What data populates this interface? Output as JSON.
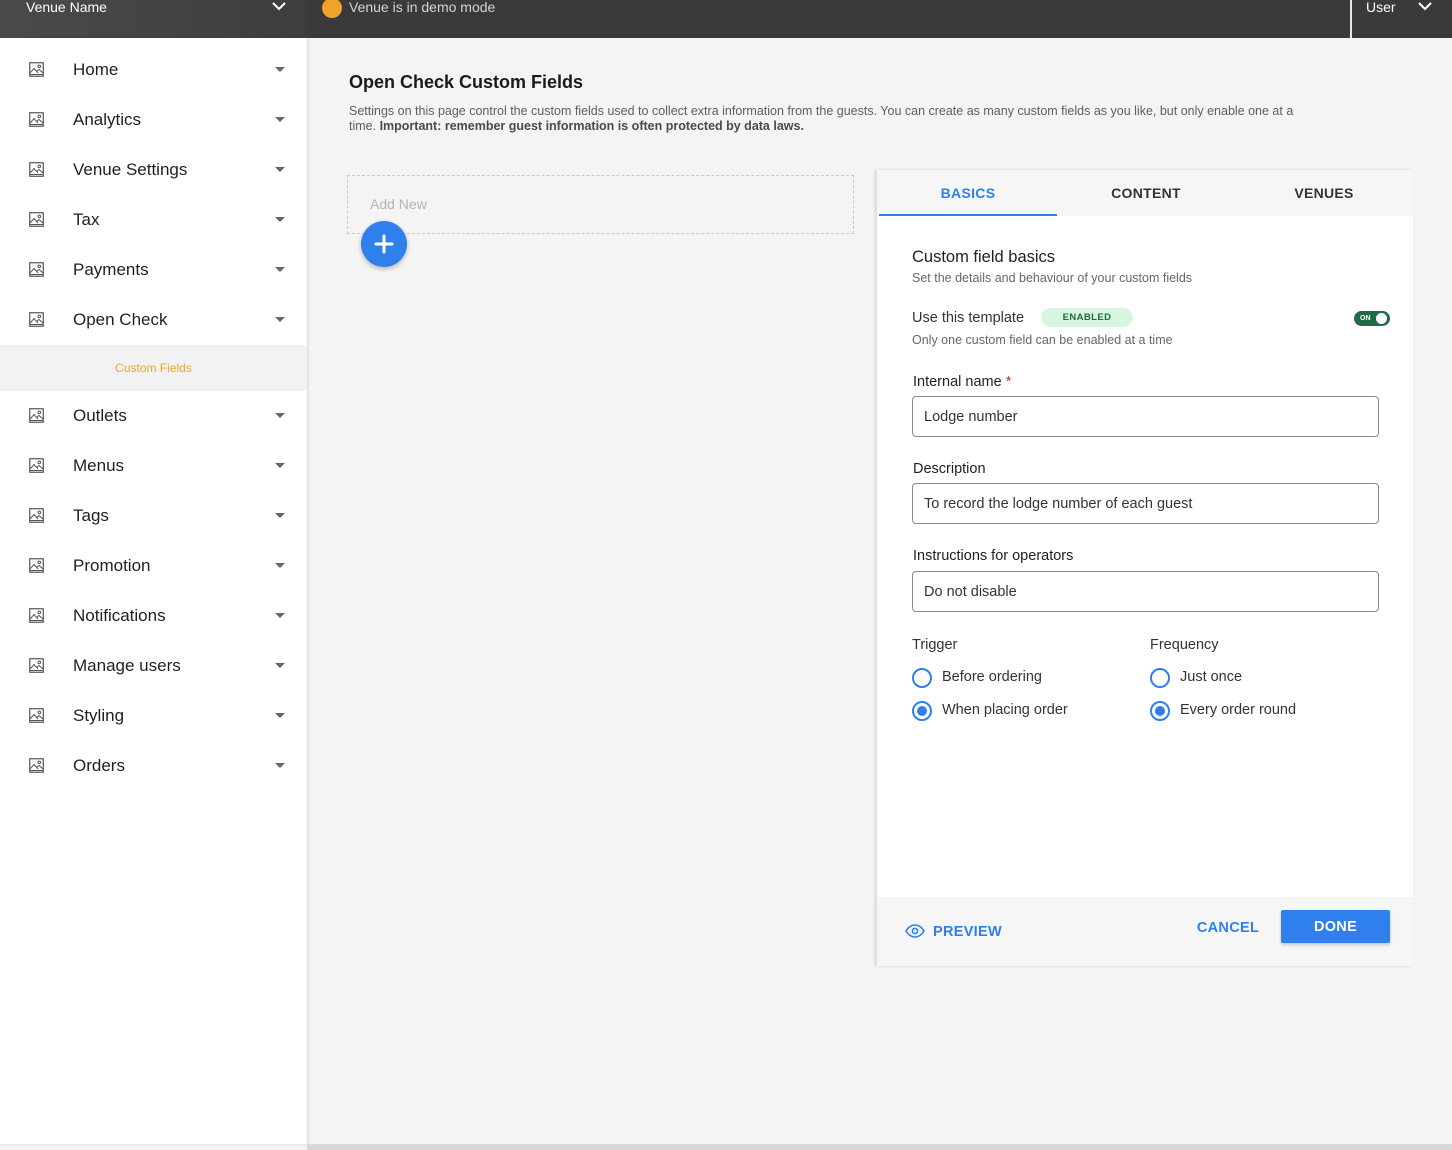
{
  "topbar": {
    "venue_name": "Venue Name",
    "demo_text": "Venue is in demo mode",
    "user_label": "User",
    "demo_color": "#f0a42c"
  },
  "sidebar": {
    "items": [
      {
        "label": "Home",
        "icon": "image-icon"
      },
      {
        "label": "Analytics",
        "icon": "image-icon"
      },
      {
        "label": "Venue Settings",
        "icon": "image-icon"
      },
      {
        "label": "Tax",
        "icon": "image-icon"
      },
      {
        "label": "Payments",
        "icon": "image-icon"
      },
      {
        "label": "Open Check",
        "icon": "image-icon"
      },
      {
        "label": "Outlets",
        "icon": "image-icon"
      },
      {
        "label": "Menus",
        "icon": "image-icon"
      },
      {
        "label": "Tags",
        "icon": "image-icon"
      },
      {
        "label": "Promotion",
        "icon": "image-icon"
      },
      {
        "label": "Notifications",
        "icon": "image-icon"
      },
      {
        "label": "Manage users",
        "icon": "image-icon"
      },
      {
        "label": "Styling",
        "icon": "image-icon"
      },
      {
        "label": "Orders",
        "icon": "image-icon"
      }
    ],
    "sub_item": "Custom Fields",
    "active_color": "#f0a42c"
  },
  "main": {
    "title": "Open Check Custom Fields",
    "description": "Settings on this page control the custom fields used to collect extra information from the guests. You can create as many custom fields as you like, but only enable one at a time. ",
    "description_strong": "Important: remember guest information is often protected by data laws.",
    "add_new": "Add New"
  },
  "panel": {
    "tabs": [
      {
        "label": "BASICS",
        "active": true
      },
      {
        "label": "CONTENT",
        "active": false
      },
      {
        "label": "VENUES",
        "active": false
      }
    ],
    "section_title": "Custom field basics",
    "section_subtitle": "Set the details and behaviour of your custom fields",
    "use_template_label": "Use this template",
    "enabled_badge": "ENABLED",
    "toggle_label": "ON",
    "only_one_note": "Only one custom field can be enabled at a time",
    "internal_name_label": "Internal name",
    "required_marker": "*",
    "internal_name_value": "Lodge number",
    "description_label": "Description",
    "description_value": "To record the lodge number of each guest",
    "instructions_label": "Instructions for operators",
    "instructions_value": "Do not disable",
    "trigger_label": "Trigger",
    "trigger_options": [
      {
        "label": "Before ordering",
        "selected": false
      },
      {
        "label": "When placing order",
        "selected": true
      }
    ],
    "frequency_label": "Frequency",
    "frequency_options": [
      {
        "label": "Just once",
        "selected": false
      },
      {
        "label": "Every order round",
        "selected": true
      }
    ],
    "preview_label": "PREVIEW",
    "cancel_label": "CANCEL",
    "done_label": "DONE",
    "accent_color": "#2f80ed"
  }
}
